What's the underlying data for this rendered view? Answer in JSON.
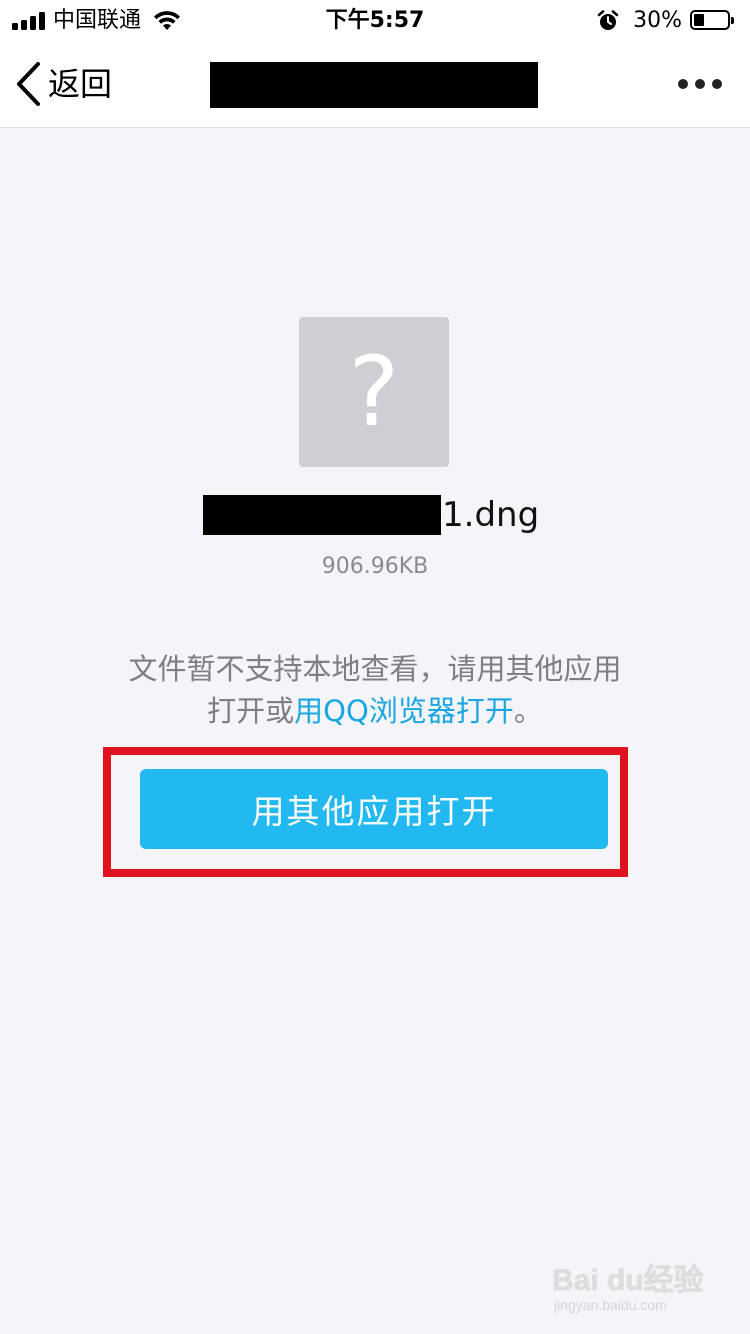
{
  "status_bar": {
    "carrier": "中国联通",
    "time": "下午5:57",
    "battery_percent": "30%",
    "battery_level": 0.3,
    "icons": [
      "signal-icon",
      "wifi-icon",
      "alarm-icon",
      "battery-icon"
    ]
  },
  "nav": {
    "back_label": "返回",
    "more_icon": "more-dots-icon"
  },
  "file": {
    "icon": "question-mark-icon",
    "icon_glyph": "?",
    "name_suffix": "1.dng",
    "size": "906.96KB"
  },
  "notice": {
    "line1": "文件暂不支持本地查看，请用其他应用",
    "line2_prefix": "打开或",
    "line2_link": "用QQ浏览器打开",
    "line2_suffix": "。"
  },
  "actions": {
    "open_with_other_app": "用其他应用打开"
  },
  "colors": {
    "accent_blue": "#22b8f0",
    "link_blue": "#1aa6e0",
    "highlight_red": "#e0141e",
    "background": "#f5f4f9"
  },
  "watermark": {
    "logo_text": "Bai du经验",
    "url": "jingyan.baidu.com"
  }
}
